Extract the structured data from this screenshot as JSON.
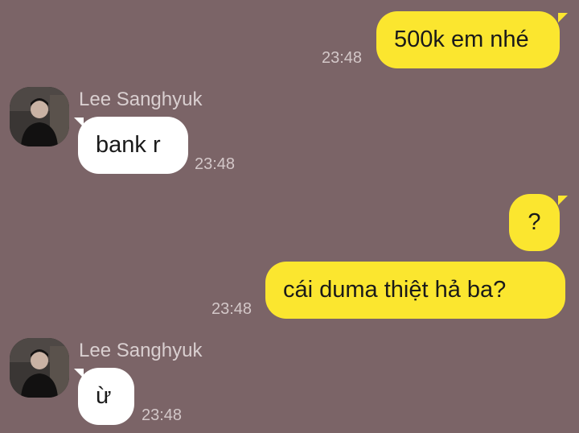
{
  "messages": [
    {
      "id": "m1",
      "direction": "outgoing",
      "text": "500k em nhé",
      "time": "23:48"
    },
    {
      "id": "m2",
      "direction": "incoming",
      "sender": "Lee Sanghyuk",
      "text": "bank r",
      "time": "23:48"
    },
    {
      "id": "m3",
      "direction": "outgoing",
      "text": "?"
    },
    {
      "id": "m4",
      "direction": "outgoing",
      "text": "cái duma thiệt hả ba?",
      "time": "23:48"
    },
    {
      "id": "m5",
      "direction": "incoming",
      "sender": "Lee Sanghyuk",
      "text": "ừ",
      "time": "23:48"
    }
  ],
  "colors": {
    "background": "#7b6467",
    "outgoing_bubble": "#fbe62f",
    "incoming_bubble": "#ffffff",
    "timestamp": "#d3c7c8"
  },
  "icons": {
    "avatar": "avatar-photo-icon"
  }
}
